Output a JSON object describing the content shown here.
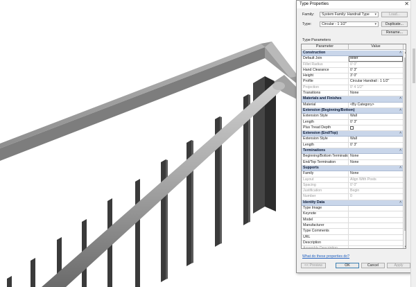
{
  "dialog": {
    "title": "Type Properties",
    "family_label": "Family:",
    "family_value": "System Family: Handrail Type",
    "type_label": "Type:",
    "type_value": "Circular - 1 1/2\"",
    "load_button": "Load...",
    "duplicate_button": "Duplicate...",
    "rename_button": "Rename...",
    "type_parameters_label": "Type Parameters",
    "grid_headers": {
      "parameter": "Parameter",
      "value": "Value"
    },
    "rows": [
      {
        "kind": "group",
        "label": "Construction"
      },
      {
        "label": "Default Join",
        "value": "Miter",
        "editing": true
      },
      {
        "label": "Fillet Radius",
        "value": "0' 0\"",
        "disabled": true
      },
      {
        "label": "Hand Clearance",
        "value": "0' 3\""
      },
      {
        "label": "Height",
        "value": "3' 0\""
      },
      {
        "label": "Profile",
        "value": "Circular Handrail : 1 1/2\""
      },
      {
        "label": "Projection",
        "value": "0' 4 1/2\"",
        "disabled": true
      },
      {
        "label": "Transitions",
        "value": "None"
      },
      {
        "kind": "group",
        "label": "Materials and Finishes"
      },
      {
        "label": "Material",
        "value": "<By Category>"
      },
      {
        "kind": "group",
        "label": "Extension (Beginning/Bottom)"
      },
      {
        "label": "Extension Style",
        "value": "Wall"
      },
      {
        "label": "Length",
        "value": "0' 3\""
      },
      {
        "label": "Plus Tread Depth",
        "value": "",
        "checkbox": true
      },
      {
        "kind": "group",
        "label": "Extension (End/Top)"
      },
      {
        "label": "Extension Style",
        "value": "Wall"
      },
      {
        "label": "Length",
        "value": "0' 3\""
      },
      {
        "kind": "group",
        "label": "Terminations"
      },
      {
        "label": "Beginning/Bottom Termination",
        "value": "None"
      },
      {
        "label": "End/Top Termination",
        "value": "None"
      },
      {
        "kind": "group",
        "label": "Supports"
      },
      {
        "label": "Family",
        "value": "None"
      },
      {
        "label": "Layout",
        "value": "Align With Posts",
        "disabled": true
      },
      {
        "label": "Spacing",
        "value": "0' 0\"",
        "disabled": true
      },
      {
        "label": "Justification",
        "value": "Begin",
        "disabled": true
      },
      {
        "label": "Number",
        "value": "0",
        "disabled": true
      },
      {
        "kind": "group",
        "label": "Identity Data"
      },
      {
        "label": "Type Image",
        "value": ""
      },
      {
        "label": "Keynote",
        "value": ""
      },
      {
        "label": "Model",
        "value": ""
      },
      {
        "label": "Manufacturer",
        "value": ""
      },
      {
        "label": "Type Comments",
        "value": ""
      },
      {
        "label": "URL",
        "value": ""
      },
      {
        "label": "Description",
        "value": ""
      },
      {
        "label": "Assembly Description",
        "value": "",
        "disabled": true
      }
    ],
    "help_link": "What do these properties do?",
    "preview_button": "<< Preview",
    "ok_button": "OK",
    "cancel_button": "Cancel",
    "apply_button": "Apply"
  },
  "colors": {
    "group_header": "#c9d6ea",
    "link": "#1f5fbf",
    "railing": "#8a8a8a"
  }
}
